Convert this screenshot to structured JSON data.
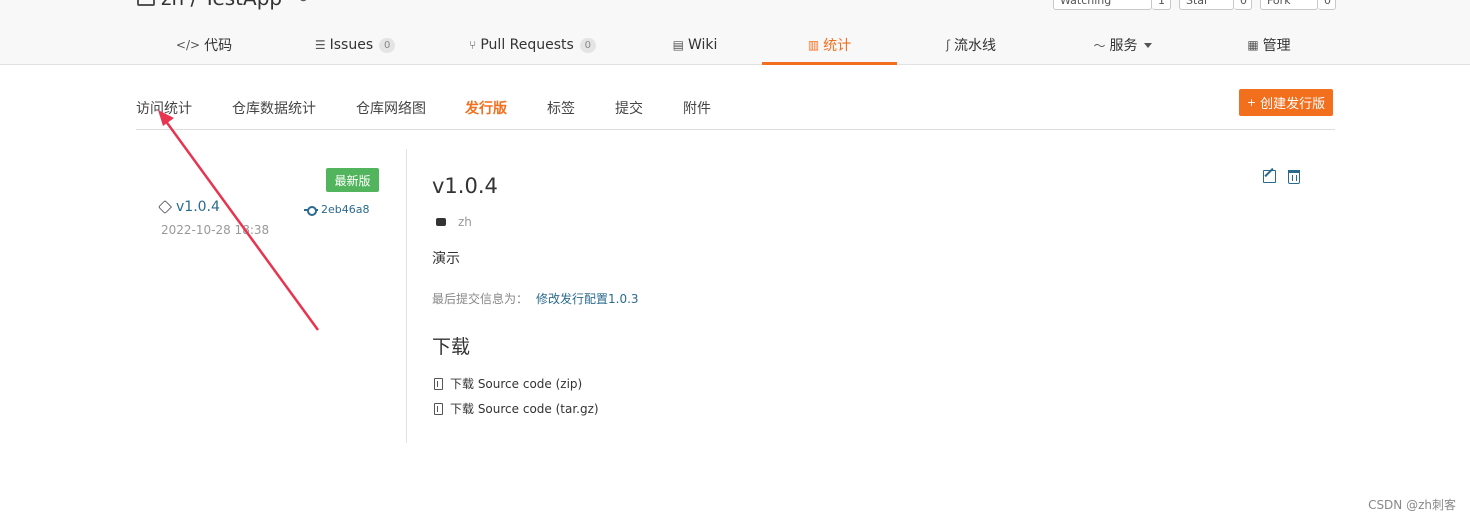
{
  "repo": {
    "title": "zh / TestApp",
    "sync_icon": "sync-icon"
  },
  "repo_actions": [
    {
      "label": "Watching",
      "count": "1"
    },
    {
      "label": "Star",
      "count": "0"
    },
    {
      "label": "Fork",
      "count": "0"
    }
  ],
  "tabs": [
    {
      "label": "代码",
      "icon": "code-icon"
    },
    {
      "label": "Issues",
      "icon": "issues-icon",
      "count": "0"
    },
    {
      "label": "Pull Requests",
      "icon": "pull-request-icon",
      "count": "0"
    },
    {
      "label": "Wiki",
      "icon": "wiki-icon"
    },
    {
      "label": "统计",
      "icon": "chart-icon",
      "active": true
    },
    {
      "label": "流水线",
      "icon": "pipeline-icon"
    },
    {
      "label": "服务",
      "icon": "service-icon"
    },
    {
      "label": "管理",
      "icon": "manage-icon"
    }
  ],
  "subnav": {
    "items": [
      "访问统计",
      "仓库数据统计",
      "仓库网络图",
      "发行版",
      "标签",
      "提交",
      "附件"
    ],
    "active": "发行版",
    "create_label": "创建发行版"
  },
  "release": {
    "badge": "最新版",
    "tag": "v1.0.4",
    "commit": "2eb46a8",
    "date": "2022-10-28 18:38",
    "title": "v1.0.4",
    "author": "zh",
    "description": "演示",
    "last_commit_label": "最后提交信息为：",
    "last_commit_msg": "修改发行配置1.0.3",
    "download_title": "下载",
    "downloads": [
      "下载 Source code (zip)",
      "下载 Source code (tar.gz)"
    ]
  },
  "watermark": "CSDN @zh刺客",
  "colors": {
    "accent": "#f26f1e",
    "link": "#2b6a8f",
    "badge": "#52b45c",
    "arrow": "#e8344e"
  }
}
